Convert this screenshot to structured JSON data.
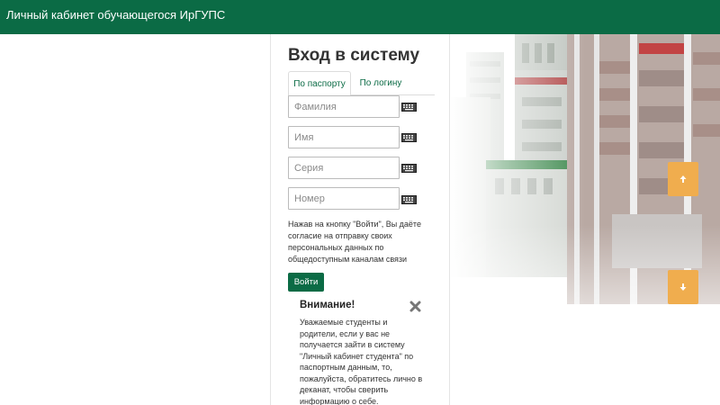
{
  "header": {
    "title": "Личный кабинет обучающегося ИрГУПС"
  },
  "login": {
    "title": "Вход в систему",
    "tabs": [
      {
        "label": "По паспорту",
        "active": true
      },
      {
        "label": "По логину",
        "active": false
      }
    ],
    "fields": {
      "surname_placeholder": "Фамилия",
      "name_placeholder": "Имя",
      "series_placeholder": "Серия",
      "number_placeholder": "Номер"
    },
    "consent_text": "Нажав на кнопку \"Войти\", Вы даёте согласие на отправку своих персональных данных по общедоступным каналам связи",
    "submit_label": "Войти"
  },
  "alert": {
    "title": "Внимание!",
    "text": "Уважаемые студенты и родители, если у вас не получается зайти в систему \"Личный кабинет студента\" по паспортным данным, то, пожалуйста, обратитесь лично в деканат, чтобы сверить информацию о себе."
  },
  "icons": {
    "keyboard": "keyboard-icon",
    "close": "close-icon",
    "scroll_up": "arrow-up-icon",
    "scroll_down": "arrow-down-icon"
  },
  "colors": {
    "brand": "#0b6b45",
    "scroll_button": "#f0ad4e",
    "text": "#333333"
  }
}
